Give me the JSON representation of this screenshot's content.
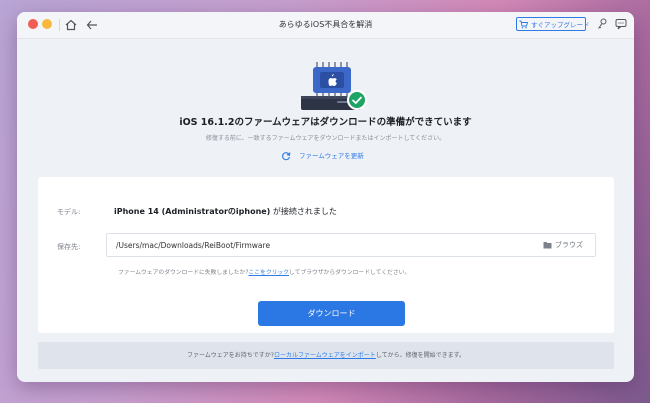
{
  "window": {
    "title": "あらゆるiOS不具合を解消",
    "upgrade_label": "すぐアップグレード"
  },
  "main": {
    "headline": "iOS 16.1.2のファームウェアはダウンロードの準備ができています",
    "subline": "修復する前に、一致するファームウェアをダウンロードまたはインポートしてください。",
    "refresh_label": "ファームウェアを更新"
  },
  "card": {
    "model_label": "モデル:",
    "model_name": "iPhone 14 (Administratorのiphone)",
    "model_status": " が接続されました",
    "save_label": "保存先:",
    "path_value": "/Users/mac/Downloads/ReiBoot/Firmware",
    "browse_label": "ブラウズ",
    "hint_before": "ファームウェアのダウンロードに失敗しましたか?",
    "hint_link": "ここをクリック",
    "hint_after": "してブラウザからダウンロードしてください。",
    "download_label": "ダウンロード"
  },
  "footer": {
    "before": "ファームウェアをお持ちですか?",
    "link": "ローカルファームウェアをインポート",
    "after": "してから、修復を開始できます。"
  },
  "colors": {
    "accent": "#2b77e3",
    "check": "#1fa463"
  }
}
